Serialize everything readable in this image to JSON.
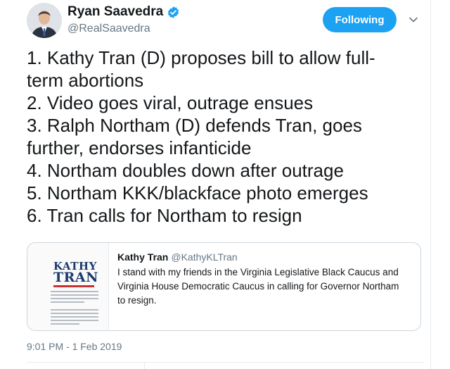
{
  "author": {
    "display_name": "Ryan Saavedra",
    "handle": "@RealSaavedra",
    "verified": true
  },
  "follow_button": {
    "label": "Following"
  },
  "tweet": {
    "lines": [
      "1. Kathy Tran (D) proposes bill to allow full-",
      "term abortions",
      "2. Video goes viral, outrage ensues",
      "3. Ralph Northam (D) defends Tran, goes",
      "further, endorses infanticide",
      "4. Northam doubles down after outrage",
      "5. Northam KKK/blackface photo emerges",
      "6. Tran calls for Northam to resign"
    ],
    "timestamp": "9:01 PM - 1 Feb 2019"
  },
  "quoted_tweet": {
    "display_name": "Kathy Tran",
    "handle": "@KathyKLTran",
    "lines": [
      "I stand with my friends in the Virginia Legislative Black Caucus and",
      "Virginia House Democratic Caucus in calling for Governor Northam",
      "to resign."
    ],
    "thumbnail": {
      "logo_line_1": "KATHY",
      "logo_line_2": "TRAN"
    }
  },
  "icons": {
    "verified": "verified-badge-icon",
    "menu": "chevron-down-icon"
  },
  "colors": {
    "accent": "#1da1f2",
    "text": "#14171a",
    "secondary": "#657786",
    "border": "#ccd6dd"
  }
}
